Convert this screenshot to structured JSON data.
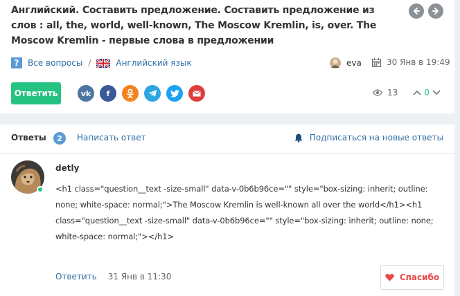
{
  "question": {
    "title": "Английский. Составить предложение. Составить предложение из слов : all, the, world, well-known, The Moscow Kremlin, is, over. The Moscow Kremlin - первые слова в предложении",
    "breadcrumb_all": "Все вопросы",
    "breadcrumb_sep": "/",
    "subject": "Английский язык",
    "author": "eva",
    "date": "30 Янв в 19:49",
    "answer_button": "Ответить",
    "share_icons": [
      "vk-icon",
      "facebook-icon",
      "odnoklassniki-icon",
      "telegram-icon",
      "twitter-icon",
      "email-icon"
    ],
    "views": "13",
    "votes": "0"
  },
  "answers": {
    "title": "Ответы",
    "count": "2",
    "write_answer": "Написать ответ",
    "subscribe": "Подписаться на новые ответы"
  },
  "answer": {
    "author": "detly",
    "text": "<h1 class=\"question__text -size-small\" data-v-0b6b96ce=\"\" style=\"box-sizing: inherit; outline: none; white-space: normal;\">The Moscow Kremlin is well-known all over the world</h1><h1 class=\"question__text -size-small\" data-v-0b6b96ce=\"\" style=\"box-sizing: inherit; outline: none; white-space: normal;\"></h1>",
    "reply": "Ответить",
    "date": "31 Янв в 11:30",
    "thanks": "Спасибо"
  },
  "colors": {
    "accent_green": "#26c281",
    "link_blue": "#2d6ea7",
    "badge_blue": "#5b9bd5",
    "thanks_red": "#e84a4a"
  }
}
